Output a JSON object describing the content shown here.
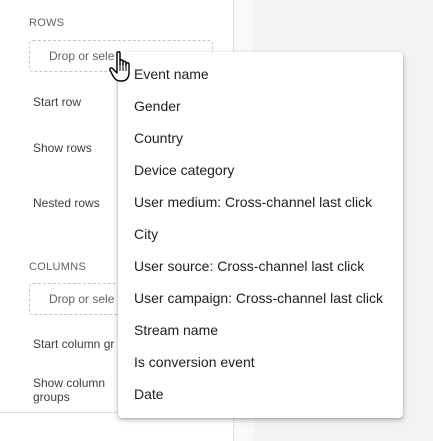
{
  "rows_section": {
    "title": "ROWS",
    "drop_placeholder": "Drop or sele",
    "start_row_label": "Start row",
    "show_rows_label": "Show rows",
    "nested_rows_label": "Nested rows"
  },
  "columns_section": {
    "title": "COLUMNS",
    "drop_placeholder": "Drop or sele",
    "start_column_group_label": "Start column gr",
    "show_column_groups_label_line1": "Show column",
    "show_column_groups_label_line2": "groups"
  },
  "dimension_menu": {
    "items": [
      "Event name",
      "Gender",
      "Country",
      "Device category",
      "User medium: Cross-channel last click",
      "City",
      "User source: Cross-channel last click",
      "User campaign: Cross-channel last click",
      "Stream name",
      "Is conversion event",
      "Date"
    ]
  },
  "cursor_icon": "hand-pointer-icon"
}
